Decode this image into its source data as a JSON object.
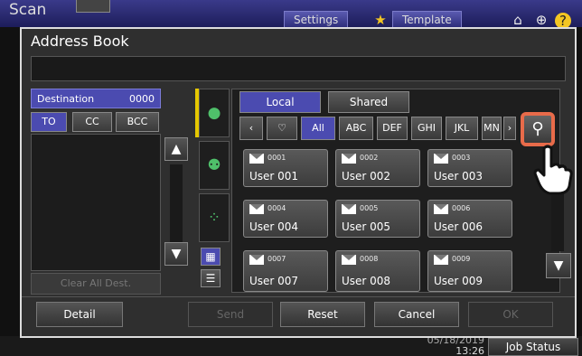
{
  "background": {
    "title": "Scan",
    "settings_label": "Settings",
    "template_label": "Template",
    "icons": [
      "star-icon",
      "home-icon",
      "globe-icon",
      "help-icon"
    ],
    "clock_date": "05/18/2019",
    "clock_time": "13:26",
    "job_status_label": "Job Status"
  },
  "dialog": {
    "title": "Address Book",
    "destination_label": "Destination",
    "destination_count": "0000",
    "dest_tabs": [
      "TO",
      "CC",
      "BCC"
    ],
    "clear_label": "Clear All Dest.",
    "source_tabs": [
      "Local",
      "Shared"
    ],
    "index_tabs": [
      "All",
      "ABC",
      "DEF",
      "GHI",
      "JKL",
      "MN"
    ],
    "users": [
      {
        "num": "0001",
        "name": "User 001"
      },
      {
        "num": "0002",
        "name": "User 002"
      },
      {
        "num": "0003",
        "name": "User 003"
      },
      {
        "num": "0004",
        "name": "User 004"
      },
      {
        "num": "0005",
        "name": "User 005"
      },
      {
        "num": "0006",
        "name": "User 006"
      },
      {
        "num": "0007",
        "name": "User 007"
      },
      {
        "num": "0008",
        "name": "User 008"
      },
      {
        "num": "0009",
        "name": "User 009"
      }
    ],
    "buttons": {
      "detail": "Detail",
      "send": "Send",
      "reset": "Reset",
      "cancel": "Cancel",
      "ok": "OK"
    }
  },
  "colors": {
    "accent_blue": "#4b4bb0",
    "active_green": "#4fc06a",
    "highlight_orange": "#e86b4a",
    "side_yellow": "#e5c700"
  }
}
